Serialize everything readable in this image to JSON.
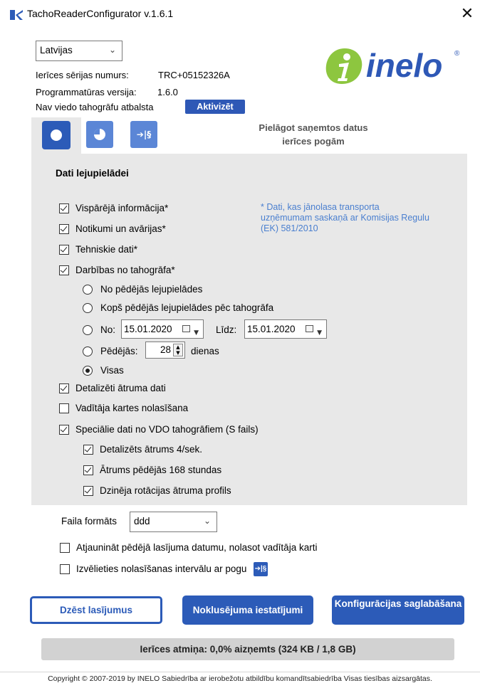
{
  "window": {
    "title": "TachoReaderConfigurator v.1.6.1",
    "close_glyph": "✕"
  },
  "device": {
    "language": "Latvijas",
    "serial_label": "Ierīces sērijas numurs:",
    "serial_value": "TRC+05152326A",
    "firmware_label": "Programmatūras versija:",
    "firmware_value": "1.6.0",
    "smart_label": "Nav viedo tahogrāfu atbalsta",
    "activate_label": "Aktivizēt"
  },
  "logo": {
    "text": "inelo",
    "mark": "®",
    "colors": {
      "leaf": "#8dc63f",
      "text": "#2e58b6"
    }
  },
  "tabs": {
    "hint": "Pielāgot saņemtos datus ierīces pogām",
    "icons": [
      "record-icon",
      "clock-icon",
      "rules-icon"
    ],
    "rules_glyph": "➔|§"
  },
  "panel": {
    "title": "Dati lejupielādei",
    "note": "* Dati, kas jānolasa transporta uzņēmumam saskaņā ar Komisijas Regulu (EK) 581/2010",
    "options": {
      "general": {
        "label": "Vispārējā informācija*",
        "checked": true
      },
      "events": {
        "label": "Notikumi un avārijas*",
        "checked": true
      },
      "technical": {
        "label": "Tehniskie dati*",
        "checked": true
      },
      "activities": {
        "label": "Darbības no tahogrāfa*",
        "checked": true
      },
      "speed": {
        "label": "Detalizēti ātruma dati",
        "checked": true
      },
      "driver_card": {
        "label": "Vadītāja kartes nolasīšana",
        "checked": false
      },
      "vdo": {
        "label": "Speciālie dati no VDO tahogrāfiem (S fails)",
        "checked": true
      },
      "vdo_speed4": {
        "label": "Detalizēts ātrums 4/sek.",
        "checked": true
      },
      "vdo_168h": {
        "label": "Ātrums pēdējās 168 stundas",
        "checked": true
      },
      "vdo_rpm": {
        "label": "Dzinēja rotācijas ātruma profils",
        "checked": true
      }
    },
    "range": {
      "since_last": "No pēdējās lejupielādes",
      "since_last_tacho": "Kopš pēdējās lejupielādes pēc tahogrāfa",
      "from_label": "No:",
      "from_value": "15.01.2020",
      "to_label": "Līdz:",
      "to_value": "15.01.2020",
      "last_label": "Pēdējās:",
      "last_value": "28",
      "days_label": "dienas",
      "all_label": "Visas",
      "selected": "all"
    }
  },
  "footer": {
    "format_label": "Faila formāts",
    "format_value": "ddd",
    "update_date_label": "Atjaunināt pēdējā lasījuma datumu, nolasot vadītāja karti",
    "update_date_checked": false,
    "interval_label": "Izvēlieties nolasīšanas intervālu ar pogu",
    "interval_checked": false,
    "clear_button": "Dzēst lasījumus",
    "defaults_button": "Noklusējuma iestatījumi",
    "save_button": "Konfigurācijas saglabāšana",
    "memory": "Ierīces atmiņa: 0,0% aizņemts (324 KB / 1,8 GB)",
    "copyright": "Copyright © 2007-2019 by INELO Sabiedrība ar ierobežotu atbildību komandītsabiedrība Visas tiesības aizsargātas."
  },
  "colors": {
    "accent": "#2c5bb8",
    "tab_inactive": "#5b86d6",
    "panel_bg": "#e8e8e8",
    "note": "#4a7fcf"
  }
}
